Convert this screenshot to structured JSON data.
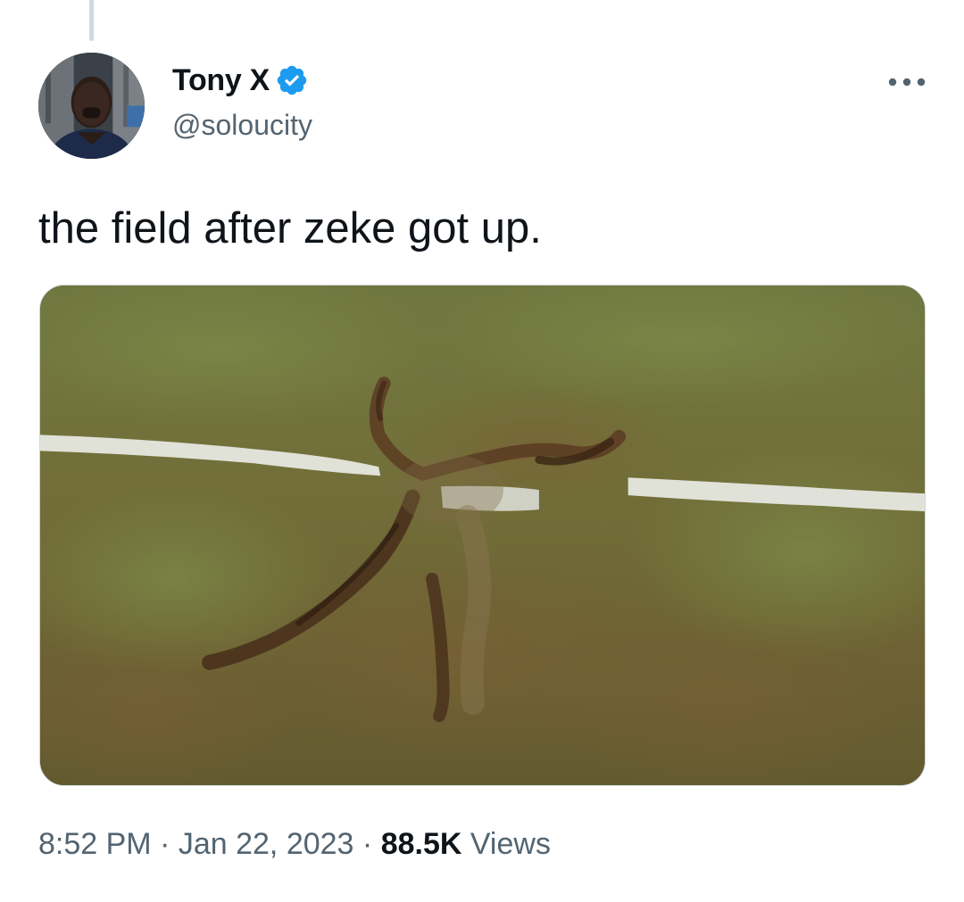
{
  "author": {
    "display_name": "Tony X",
    "handle": "@soloucity",
    "verified_icon": "verified-badge-icon",
    "verified_color": "#1d9bf0"
  },
  "menu": {
    "more_icon": "more-horizontal-icon"
  },
  "tweet": {
    "text": "the field after zeke got up."
  },
  "media": {
    "kind": "photo"
  },
  "meta": {
    "time": "8:52 PM",
    "separator": " · ",
    "date": "Jan 22, 2023",
    "views_count": "88.5K",
    "views_label": " Views"
  },
  "colors": {
    "text_primary": "#0f1419",
    "text_secondary": "#536471",
    "accent": "#1d9bf0",
    "border": "#cfd9de"
  }
}
